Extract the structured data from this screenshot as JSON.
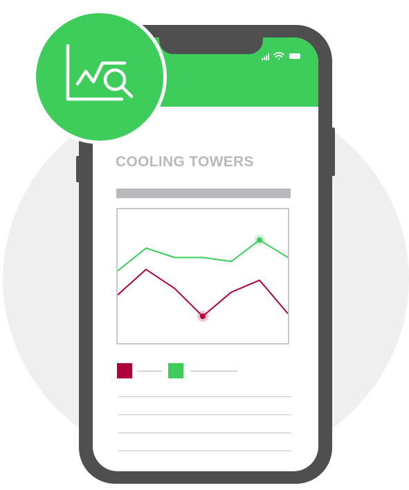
{
  "app": {
    "title": "COOLING TOWERS"
  },
  "colors": {
    "accent": "#3ecc5a",
    "series_red": "#b0003a",
    "series_green": "#3ecc5a",
    "phone_body": "#4f4f4f",
    "muted_gray": "#b9b9bd"
  },
  "icons": {
    "badge": "chart-magnifier-icon",
    "status": [
      "signal-icon",
      "wifi-icon",
      "battery-icon"
    ]
  },
  "chart_data": {
    "type": "line",
    "x": [
      0,
      1,
      2,
      3,
      4,
      5,
      6
    ],
    "series": [
      {
        "color": "#3ecc5a",
        "values": [
          0.54,
          0.71,
          0.64,
          0.64,
          0.61,
          0.77,
          0.64
        ],
        "highlight_index": 5
      },
      {
        "color": "#b0003a",
        "values": [
          0.36,
          0.55,
          0.41,
          0.2,
          0.38,
          0.47,
          0.22
        ],
        "highlight_index": 3
      }
    ],
    "ylim": [
      0,
      1
    ],
    "grid": false,
    "legend": "below"
  },
  "content": {
    "text_line_count": 4
  }
}
